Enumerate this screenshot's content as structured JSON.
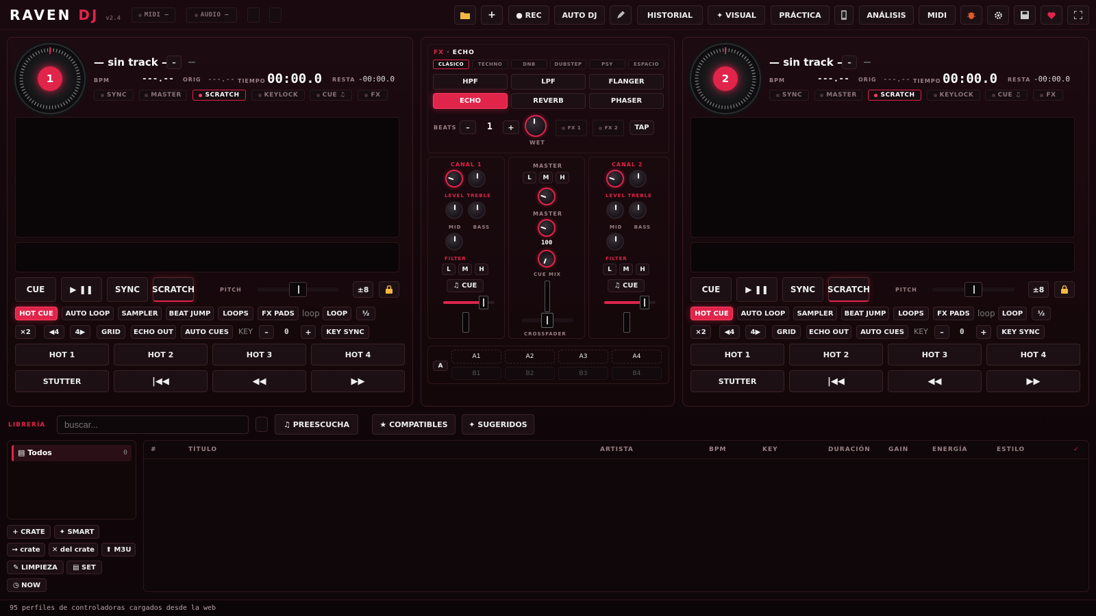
{
  "app": {
    "logo_a": "RAVEN",
    "logo_b": "DJ",
    "version": "v2.4",
    "midi": "MIDI —",
    "audio": "AUDIO —"
  },
  "topbar": {
    "folder_icon": "folder-icon",
    "add": "+",
    "rec": "● REC",
    "auto_dj": "AUTO DJ",
    "edit_icon": "pen-icon",
    "historial": "HISTORIAL",
    "visual": "✦ VISUAL",
    "practica": "PRÁCTICA",
    "phone_icon": "phone-icon",
    "analisis": "ANÁLISIS",
    "midi": "MIDI",
    "bug_icon": "bug-icon",
    "gear_icon": "gear-icon",
    "save_icon": "save-icon",
    "heart_icon": "heart-icon",
    "fullscreen_icon": "fullscreen-icon"
  },
  "decks": [
    {
      "number": "1",
      "title": "— sin track —",
      "minus": "–",
      "bpm_label": "BPM",
      "bpm": "---.--",
      "orig_label": "ORIG",
      "orig": "---.--",
      "tiempo_label": "TIEMPO",
      "time": "00:00.0",
      "resta_label": "RESTA",
      "remaining": "-00:00.0",
      "pills": [
        "SYNC",
        "MASTER",
        "SCRATCH",
        "KEYLOCK",
        "CUE ♫",
        "FX"
      ],
      "transport": {
        "cue": "CUE",
        "play": "▶ ❚❚",
        "sync": "SYNC",
        "scratch": "SCRATCH",
        "pitch_label": "PITCH",
        "range": "±8",
        "lock": "🔒"
      },
      "modes": [
        "HOT CUE",
        "AUTO LOOP",
        "SAMPLER",
        "BEAT JUMP",
        "LOOPS",
        "FX PADS"
      ],
      "loop_text": "loop",
      "loop_btn": "LOOP",
      "half": "½",
      "row2": [
        "×2",
        "◀4",
        "4▶",
        "GRID",
        "ECHO OUT",
        "AUTO CUES"
      ],
      "key_label": "KEY",
      "key_minus": "–",
      "key_value": "0",
      "key_plus": "+",
      "key_sync": "KEY SYNC",
      "pads": [
        "HOT 1",
        "HOT 2",
        "HOT 3",
        "HOT 4"
      ],
      "pads2": [
        "STUTTER",
        "|◀◀",
        "◀◀",
        "▶▶"
      ]
    },
    {
      "number": "2",
      "title": "— sin track —",
      "minus": "–",
      "bpm_label": "BPM",
      "bpm": "---.--",
      "orig_label": "ORIG",
      "orig": "---.--",
      "tiempo_label": "TIEMPO",
      "time": "00:00.0",
      "resta_label": "RESTA",
      "remaining": "-00:00.0",
      "pills": [
        "SYNC",
        "MASTER",
        "SCRATCH",
        "KEYLOCK",
        "CUE ♫",
        "FX"
      ],
      "transport": {
        "cue": "CUE",
        "play": "▶ ❚❚",
        "sync": "SYNC",
        "scratch": "SCRATCH",
        "pitch_label": "PITCH",
        "range": "±8",
        "lock": "🔒"
      },
      "modes": [
        "HOT CUE",
        "AUTO LOOP",
        "SAMPLER",
        "BEAT JUMP",
        "LOOPS",
        "FX PADS"
      ],
      "loop_text": "loop",
      "loop_btn": "LOOP",
      "half": "½",
      "row2": [
        "×2",
        "◀4",
        "4▶",
        "GRID",
        "ECHO OUT",
        "AUTO CUES"
      ],
      "key_label": "KEY",
      "key_minus": "–",
      "key_value": "0",
      "key_plus": "+",
      "key_sync": "KEY SYNC",
      "pads": [
        "HOT 1",
        "HOT 2",
        "HOT 3",
        "HOT 4"
      ],
      "pads2": [
        "STUTTER",
        "|◀◀",
        "◀◀",
        "▶▶"
      ]
    }
  ],
  "fx": {
    "label": "FX",
    "current": "ECHO",
    "styles": [
      "CLÁSICO",
      "TECHNO",
      "DNB",
      "DUBSTEP",
      "PSY",
      "ESPACIO"
    ],
    "effects": [
      "HPF",
      "LPF",
      "FLANGER",
      "ECHO",
      "REVERB",
      "PHASER"
    ],
    "beats_label": "BEATS",
    "beats_minus": "–",
    "beats_value": "1",
    "beats_plus": "+",
    "wet": "WET",
    "fx1": "FX 1",
    "fx2": "FX 2",
    "tap": "TAP"
  },
  "mixer": {
    "canal1": "CANAL 1",
    "canal2": "CANAL 2",
    "master": "MASTER",
    "level_treble": "LEVEL TREBLE",
    "mid_bass": "MID     BASS",
    "filter": "FILTER",
    "l": "L",
    "m": "M",
    "h": "H",
    "cue": "♫ CUE",
    "master_label": "MASTER",
    "master_value": "100",
    "cue_mix": "CUE MIX",
    "crossfader": "CROSSFADER"
  },
  "sampler": {
    "bank": "A",
    "pads": [
      "A1",
      "A2",
      "A3",
      "A4"
    ],
    "pads_b": [
      "B1",
      "B2",
      "B3",
      "B4"
    ]
  },
  "library": {
    "label": "LIBRERÍA",
    "search_placeholder": "buscar...",
    "preescucha": "♫ PREESCUCHA",
    "compatibles": "★ COMPATIBLES",
    "sugeridos": "✦ SUGERIDOS",
    "sidebar": {
      "todos": "▤ Todos",
      "count": "0"
    },
    "buttons": [
      "+ CRATE",
      "✦ SMART",
      "→ crate",
      "✕ del crate",
      "⬆ M3U",
      "✎ LIMPIEZA",
      "▤ SET",
      "◷ NOW"
    ],
    "columns": [
      "#",
      "TÍTULO",
      "ARTISTA",
      "BPM",
      "KEY",
      "DURACIÓN",
      "GAIN",
      "ENERGÍA",
      "ESTILO",
      "✓"
    ]
  },
  "status": "95 perfiles de controladoras cargados desde la web",
  "colors": {
    "accent": "#e0244a",
    "bg": "#12070b"
  }
}
